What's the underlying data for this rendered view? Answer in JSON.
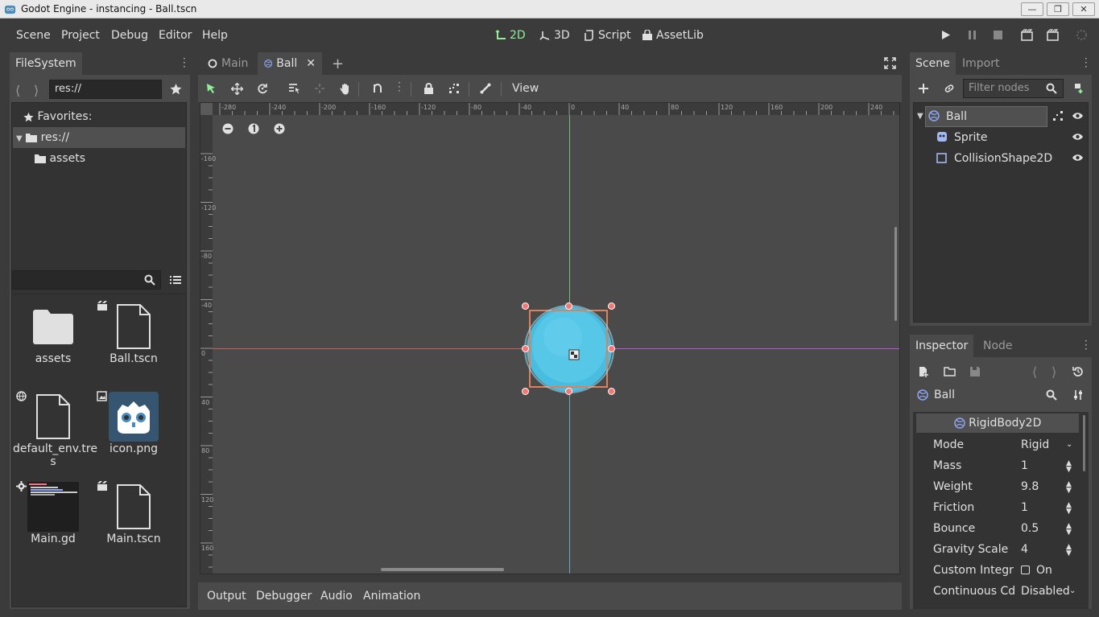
{
  "window": {
    "title": "Godot Engine - instancing - Ball.tscn"
  },
  "menus": [
    "Scene",
    "Project",
    "Debug",
    "Editor",
    "Help"
  ],
  "workspaces": {
    "w2d": "2D",
    "w3d": "3D",
    "script": "Script",
    "assetlib": "AssetLib"
  },
  "filesystem": {
    "tab": "FileSystem",
    "path": "res://",
    "favorites": "Favorites:",
    "tree": {
      "root": "res://",
      "assets": "assets"
    },
    "files": {
      "f0": "assets",
      "f1": "Ball.tscn",
      "f2a": "default_env.tre",
      "f2b": "s",
      "f3": "icon.png",
      "f4": "Main.gd",
      "f5": "Main.tscn"
    }
  },
  "scene_tabs": {
    "main": "Main",
    "ball": "Ball"
  },
  "toolbar": {
    "view": "View"
  },
  "ruler": {
    "h": [
      "-280",
      "-240",
      "-200",
      "-160",
      "-120",
      "-80",
      "-40",
      "0",
      "40",
      "80",
      "120",
      "160",
      "200",
      "240"
    ],
    "v": [
      "-160",
      "-120",
      "-80",
      "-40",
      "0",
      "40",
      "80",
      "120",
      "160"
    ]
  },
  "bottom_tabs": {
    "output": "Output",
    "debugger": "Debugger",
    "audio": "Audio",
    "animation": "Animation"
  },
  "scene_dock": {
    "tabs": {
      "scene": "Scene",
      "import": "Import"
    },
    "filter_placeholder": "Filter nodes",
    "nodes": {
      "ball": "Ball",
      "sprite": "Sprite",
      "collision": "CollisionShape2D"
    }
  },
  "inspector": {
    "tabs": {
      "inspector": "Inspector",
      "node": "Node"
    },
    "object": "Ball",
    "class": "RigidBody2D",
    "props": {
      "mode": {
        "k": "Mode",
        "v": "Rigid"
      },
      "mass": {
        "k": "Mass",
        "v": "1"
      },
      "weight": {
        "k": "Weight",
        "v": "9.8"
      },
      "friction": {
        "k": "Friction",
        "v": "1"
      },
      "bounce": {
        "k": "Bounce",
        "v": "0.5"
      },
      "gravity": {
        "k": "Gravity Scale",
        "v": "4"
      },
      "custom": {
        "k": "Custom Integr",
        "v": "On"
      },
      "continuous": {
        "k": "Continuous Cd",
        "v": "Disabled"
      }
    }
  },
  "colors": {
    "accent": "#8eef97",
    "ball": "#49bde0",
    "selection": "#e0805b",
    "handle": "#f47775"
  }
}
